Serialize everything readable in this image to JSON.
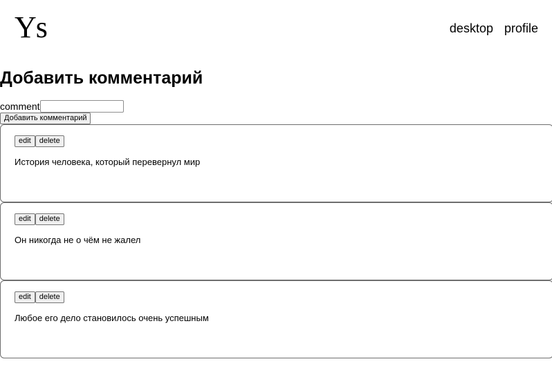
{
  "header": {
    "logo": "Ys",
    "nav": [
      {
        "label": "desktop"
      },
      {
        "label": "profile"
      }
    ]
  },
  "main": {
    "title": "Добавить комментарий",
    "form": {
      "label": "comment",
      "input_value": "",
      "submit_label": "Добавить комментарий"
    },
    "comments": [
      {
        "edit_label": "edit",
        "delete_label": "delete",
        "text": "История человека, который перевернул мир"
      },
      {
        "edit_label": "edit",
        "delete_label": "delete",
        "text": "Он никогда не о чём не жалел"
      },
      {
        "edit_label": "edit",
        "delete_label": "delete",
        "text": "Любое его дело становилось очень успешным"
      }
    ]
  }
}
